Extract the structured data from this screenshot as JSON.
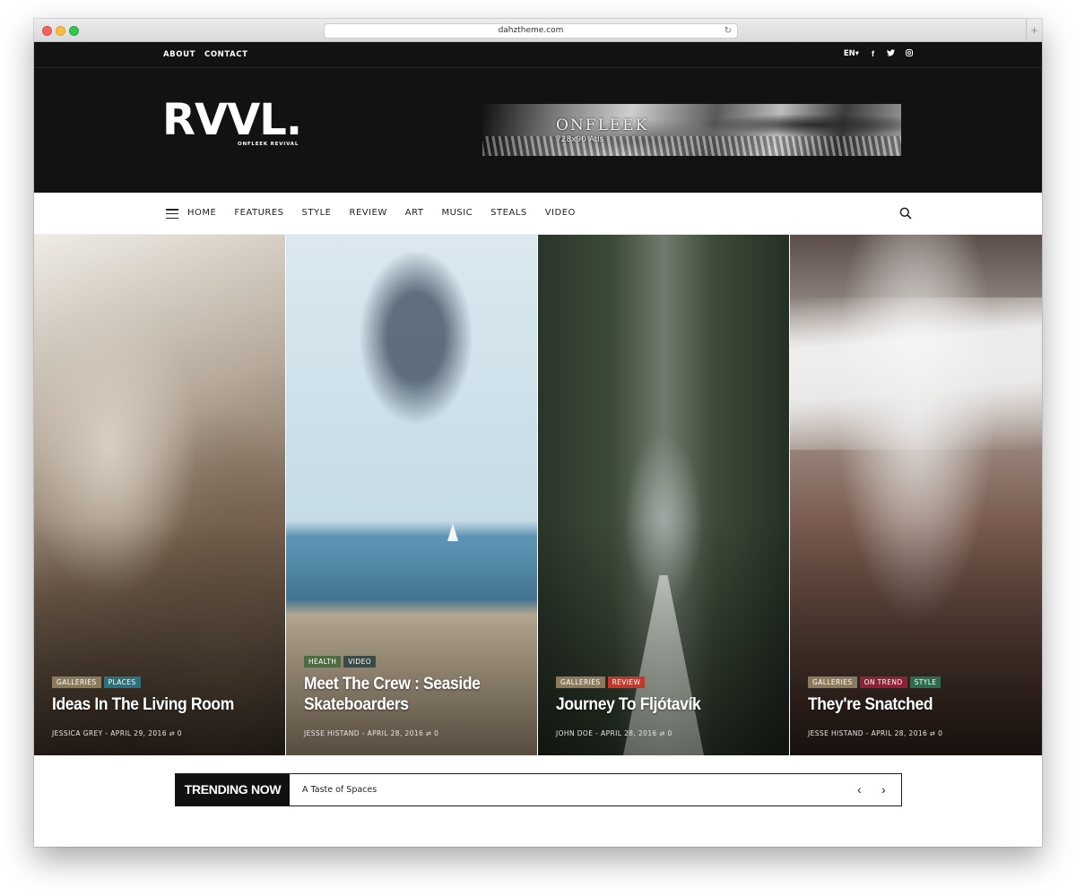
{
  "browser": {
    "url": "dahztheme.com",
    "reload_icon": "↻",
    "newtab_icon": "+"
  },
  "topbar": {
    "links": [
      "ABOUT",
      "CONTACT"
    ],
    "language": "EN▾",
    "social": {
      "facebook": "f",
      "twitter": "t",
      "instagram": "◻"
    }
  },
  "header": {
    "logo": "RVVL.",
    "tagline": "ONFLEEK REVIVAL",
    "ad": {
      "title": "ONFLEEK",
      "size": "728x90 Ads"
    }
  },
  "nav": {
    "items": [
      "HOME",
      "FEATURES",
      "STYLE",
      "REVIEW",
      "ART",
      "MUSIC",
      "STEALS",
      "VIDEO"
    ]
  },
  "cards": [
    {
      "tags": [
        "GALLERIES",
        "PLACES"
      ],
      "title": "Ideas In The Living Room",
      "byline": "JESSICA GREY - APRIL 29, 2016 ",
      "comments": "0"
    },
    {
      "tags": [
        "HEALTH",
        "VIDEO"
      ],
      "title": "Meet The Crew : Seaside Skateboarders",
      "byline": "JESSE HISTAND - APRIL 28, 2016 ",
      "comments": "0"
    },
    {
      "tags": [
        "GALLERIES",
        "REVIEW"
      ],
      "title": "Journey To Fljótavík",
      "byline": "JOHN DOE - APRIL 28, 2016 ",
      "comments": "0"
    },
    {
      "tags": [
        "GALLERIES",
        "ON TREND",
        "STYLE"
      ],
      "title": "They're Snatched",
      "byline": "JESSE HISTAND - APRIL 28, 2016 ",
      "comments": "0"
    }
  ],
  "trending": {
    "label": "TRENDING NOW",
    "headline": "A Taste of Spaces",
    "prev": "‹",
    "next": "›"
  },
  "colors": {
    "header_bg": "#121212",
    "tag_galleries": "#8b7b5c",
    "tag_places": "#2e6f7c",
    "tag_health": "#4b6d3f",
    "tag_review": "#c0392b",
    "tag_ontrend": "#8e2134",
    "tag_style": "#2e6b4e"
  }
}
